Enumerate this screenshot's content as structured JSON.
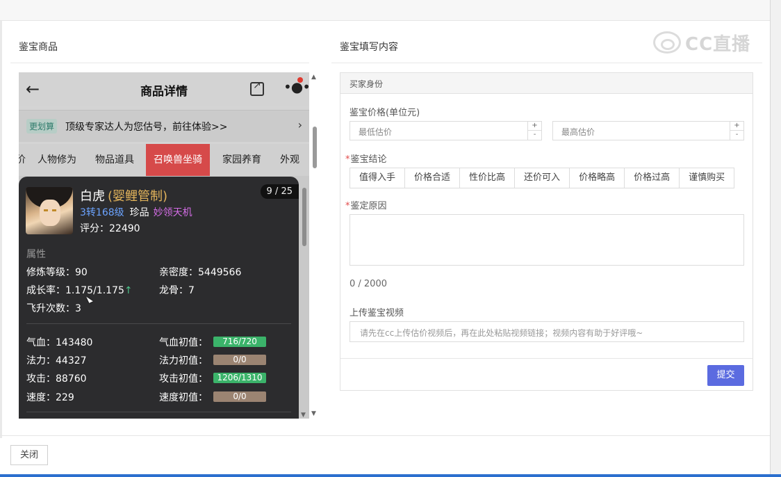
{
  "left_section": {
    "title": "鉴宝商品"
  },
  "right_section": {
    "title": "鉴宝填写内容"
  },
  "watermark": {
    "text": "CC直播"
  },
  "phone": {
    "header_title": "商品详情",
    "banner_tag": "更划算",
    "banner_text": "顶级专家达人为您估号，前往体验>>",
    "tabs": [
      "价",
      "人物修为",
      "物品道具",
      "召唤兽坐骑",
      "家园养育",
      "外观"
    ],
    "active_tab": "召唤兽坐骑",
    "card": {
      "name": "白虎",
      "name_suffix": "(婴鲤管制)",
      "counter": "9 / 25",
      "level": "3转168级",
      "quality": "珍品",
      "skill": "妙领天机",
      "score": "评分：22490",
      "attr_title": "属性",
      "attrs": {
        "cultivation": "修炼等级：90",
        "intimacy": "亲密度：5449566",
        "growth": "成长率：1.175/1.175",
        "growth_arrow": "↑",
        "dragon_bone": "龙骨：7",
        "ascension": "飞升次数：3"
      },
      "stats": [
        {
          "label": "气血：143480",
          "init_label": "气血初值：",
          "init_value": "716/720",
          "bar": "green"
        },
        {
          "label": "法力：44327",
          "init_label": "法力初值：",
          "init_value": "0/0",
          "bar": "brown"
        },
        {
          "label": "攻击：88760",
          "init_label": "攻击初值：",
          "init_value": "1206/1310",
          "bar": "green"
        },
        {
          "label": "速度：229",
          "init_label": "速度初值：",
          "init_value": "0/0",
          "bar": "brown"
        }
      ]
    }
  },
  "form": {
    "header": "买家身份",
    "price_label": "鉴宝价格(单位元)",
    "min_placeholder": "最低估价",
    "max_placeholder": "最高估价",
    "conclusion_label": "鉴宝结论",
    "conclusions": [
      "值得入手",
      "价格合适",
      "性价比高",
      "还价可入",
      "价格略高",
      "价格过高",
      "谨慎购买"
    ],
    "reason_label": "鉴定原因",
    "reason_count": "0 / 2000",
    "video_label": "上传鉴宝视频",
    "video_placeholder": "请先在cc上传估价视频后，再在此处粘贴视频链接；视频内容有助于好评哦~",
    "submit": "提交"
  },
  "footer": {
    "close": "关闭"
  }
}
